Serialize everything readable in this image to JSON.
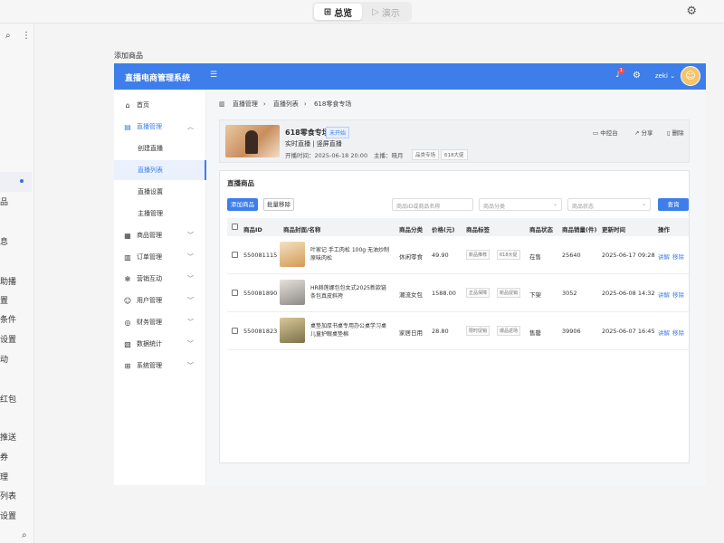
{
  "topbar": {
    "tab_overview": "总览",
    "tab_present": "演示"
  },
  "left_strip": {
    "items": [
      "息",
      "助播",
      "置",
      "条件",
      "设置",
      "动",
      "红包",
      "推送",
      "券",
      "理",
      "列表",
      "设置"
    ],
    "first_item": "品"
  },
  "page_label": "添加商品",
  "header": {
    "title": "直播电商管理系统",
    "username": "zeki",
    "badge_count": "1"
  },
  "sidebar": {
    "items": [
      {
        "label": "首页",
        "icon": "home-icon"
      },
      {
        "label": "直播管理",
        "icon": "live-icon"
      },
      {
        "label": "创建直播"
      },
      {
        "label": "直播列表"
      },
      {
        "label": "直播设置"
      },
      {
        "label": "主播管理"
      },
      {
        "label": "商品管理",
        "icon": "goods-icon"
      },
      {
        "label": "订单管理",
        "icon": "order-icon"
      },
      {
        "label": "营销互动",
        "icon": "marketing-icon"
      },
      {
        "label": "用户管理",
        "icon": "user-icon"
      },
      {
        "label": "财务管理",
        "icon": "finance-icon"
      },
      {
        "label": "数据统计",
        "icon": "stats-icon"
      },
      {
        "label": "系统管理",
        "icon": "system-icon"
      }
    ]
  },
  "breadcrumb": {
    "l1": "直播管理",
    "l2": "直播列表",
    "l3": "618零食专场"
  },
  "live": {
    "name": "618零食专场",
    "status": "未开始",
    "type": "实时直播 | 竖屏直播",
    "start_time": "开播时间：2025-06-18 20:00",
    "host": "主播：晓月",
    "tags": [
      "品类专场",
      "618大促"
    ],
    "actions": {
      "console": "中控台",
      "share": "分享",
      "delete": "删除"
    }
  },
  "goods": {
    "title": "直播商品",
    "add_button": "添加商品",
    "batch_remove": "批量移除",
    "search_placeholder": "商品ID或商品名称",
    "category_placeholder": "商品分类",
    "status_placeholder": "商品状态",
    "query_button": "查询",
    "columns": [
      "商品ID",
      "商品封面/名称",
      "商品分类",
      "价格(元)",
      "商品标签",
      "商品状态",
      "商品销量(件)",
      "更新时间",
      "操作"
    ],
    "rows": [
      {
        "id": "550081115",
        "name": "叶家记 手工肉松 100g 无油炒制原味肉松",
        "category": "休闲零食",
        "price": "49.90",
        "tags": [
          "新品推荐",
          "618大促"
        ],
        "status": "在售",
        "sales": "25640",
        "updated": "2025-06-17 09:28",
        "op_explain": "讲解",
        "op_remove": "移除"
      },
      {
        "id": "550081890",
        "name": "HR赫莲娜包包女式2025新款链条包真皮斜挎",
        "category": "潮流女包",
        "price": "1588.00",
        "tags": [
          "正品保障",
          "新品促销"
        ],
        "status": "下架",
        "sales": "3052",
        "updated": "2025-06-08 14:32",
        "op_explain": "讲解",
        "op_remove": "移除"
      },
      {
        "id": "550081823",
        "name": "桌垫加厚书桌专用办公桌学习桌儿童护眼桌垫棉",
        "category": "家居日用",
        "price": "28.80",
        "tags": [
          "限时促销",
          "爆品返场"
        ],
        "status": "售罄",
        "sales": "39906",
        "updated": "2025-06-07 16:45",
        "op_explain": "讲解",
        "op_remove": "移除"
      }
    ]
  },
  "colors": {
    "primary": "#3d7eea",
    "header": "#3d7eea"
  }
}
